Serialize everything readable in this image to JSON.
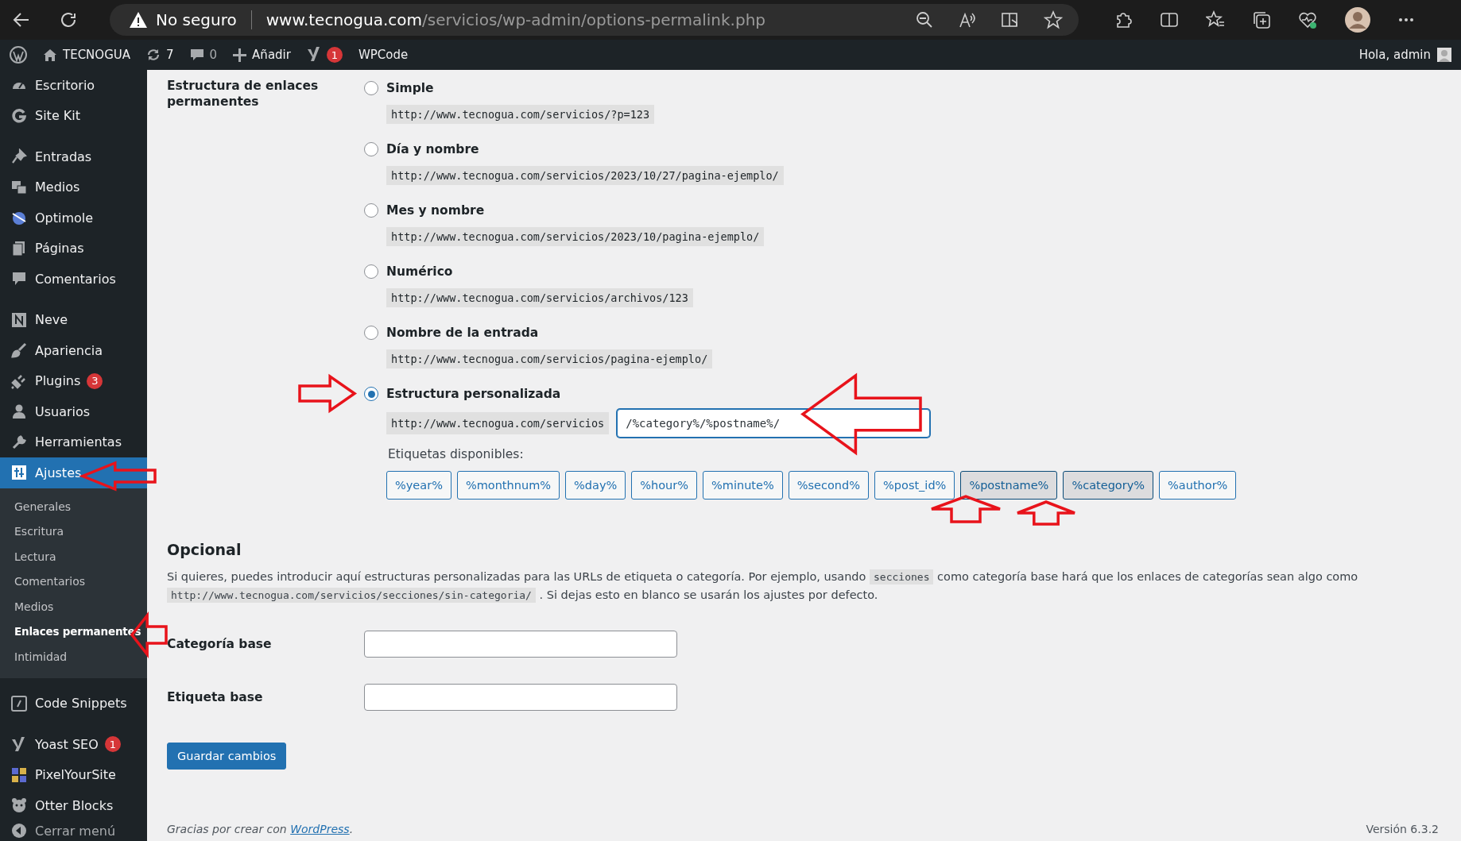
{
  "browser": {
    "security_label": "No seguro",
    "url_domain": "www.tecnogua.com",
    "url_path": "/servicios/wp-admin/options-permalink.php"
  },
  "admin_bar": {
    "site": "TECNOGUA",
    "updates": "7",
    "comments": "0",
    "new": "Añadir",
    "seo_badge": "1",
    "plugin_link": "WPCode",
    "greeting": "Hola, admin"
  },
  "sidebar": {
    "groups": [
      {
        "items": [
          {
            "label": "Escritorio",
            "selected": false
          },
          {
            "label": "Site Kit",
            "selected": false
          }
        ]
      },
      {
        "items": [
          {
            "label": "Entradas",
            "selected": false
          },
          {
            "label": "Medios",
            "selected": false
          },
          {
            "label": "Optimole",
            "selected": false
          },
          {
            "label": "Páginas",
            "selected": false
          },
          {
            "label": "Comentarios",
            "selected": false
          }
        ]
      },
      {
        "items": [
          {
            "label": "Neve",
            "selected": false
          },
          {
            "label": "Apariencia",
            "selected": false
          },
          {
            "label": "Plugins",
            "badge": "3",
            "selected": false
          },
          {
            "label": "Usuarios",
            "selected": false
          },
          {
            "label": "Herramientas",
            "selected": false
          },
          {
            "label": "Ajustes",
            "selected": true,
            "children": [
              {
                "label": "Generales",
                "selected": false
              },
              {
                "label": "Escritura",
                "selected": false
              },
              {
                "label": "Lectura",
                "selected": false
              },
              {
                "label": "Comentarios",
                "selected": false
              },
              {
                "label": "Medios",
                "selected": false
              },
              {
                "label": "Enlaces permanentes",
                "selected": true
              },
              {
                "label": "Intimidad",
                "selected": false
              }
            ]
          }
        ]
      },
      {
        "items": [
          {
            "label": "Code Snippets",
            "selected": false
          }
        ]
      },
      {
        "items": [
          {
            "label": "Yoast SEO",
            "badge": "1",
            "selected": false
          },
          {
            "label": "PixelYourSite",
            "selected": false
          },
          {
            "label": "Otter Blocks",
            "selected": false
          }
        ]
      }
    ],
    "collapse": "Cerrar menú"
  },
  "permalinks": {
    "label": "Estructura de enlaces permanentes",
    "options": [
      {
        "kind": "preset",
        "label": "Simple",
        "example": "http://www.tecnogua.com/servicios/?p=123",
        "selected": false
      },
      {
        "kind": "preset",
        "label": "Día y nombre",
        "example": "http://www.tecnogua.com/servicios/2023/10/27/pagina-ejemplo/",
        "selected": false
      },
      {
        "kind": "preset",
        "label": "Mes y nombre",
        "example": "http://www.tecnogua.com/servicios/2023/10/pagina-ejemplo/",
        "selected": false
      },
      {
        "kind": "preset",
        "label": "Numérico",
        "example": "http://www.tecnogua.com/servicios/archivos/123",
        "selected": false
      },
      {
        "kind": "preset",
        "label": "Nombre de la entrada",
        "example": "http://www.tecnogua.com/servicios/pagina-ejemplo/",
        "selected": false
      },
      {
        "kind": "custom",
        "label": "Estructura personalizada",
        "prefix": "http://www.tecnogua.com/servicios",
        "value": "/%category%/%postname%/",
        "selected": true
      }
    ],
    "tags_label": "Etiquetas disponibles:",
    "tags": [
      {
        "label": "%year%",
        "selected": false
      },
      {
        "label": "%monthnum%",
        "selected": false
      },
      {
        "label": "%day%",
        "selected": false
      },
      {
        "label": "%hour%",
        "selected": false
      },
      {
        "label": "%minute%",
        "selected": false
      },
      {
        "label": "%second%",
        "selected": false
      },
      {
        "label": "%post_id%",
        "selected": false
      },
      {
        "label": "%postname%",
        "selected": true
      },
      {
        "label": "%category%",
        "selected": true
      },
      {
        "label": "%author%",
        "selected": false
      }
    ]
  },
  "optional": {
    "title": "Opcional",
    "description": [
      {
        "kind": "text",
        "text": "Si quieres, puedes introducir aquí estructuras personalizadas para las URLs de etiqueta o categoría. Por ejemplo, usando "
      },
      {
        "kind": "code",
        "text": "secciones"
      },
      {
        "kind": "text",
        "text": " como categoría base hará que los enlaces de categorías sean algo como "
      },
      {
        "kind": "code",
        "text": "http://www.tecnogua.com/servicios/secciones/sin-categoria/"
      },
      {
        "kind": "text",
        "text": " . Si dejas esto en blanco se usarán los ajustes por defecto."
      }
    ],
    "fields": [
      {
        "label": "Categoría base"
      },
      {
        "label": "Etiqueta base"
      }
    ],
    "button": "Guardar cambios"
  },
  "footer": {
    "thanks": "Gracias por crear con ",
    "link": "WordPress",
    "period": ".",
    "version": "Versión 6.3.2"
  }
}
